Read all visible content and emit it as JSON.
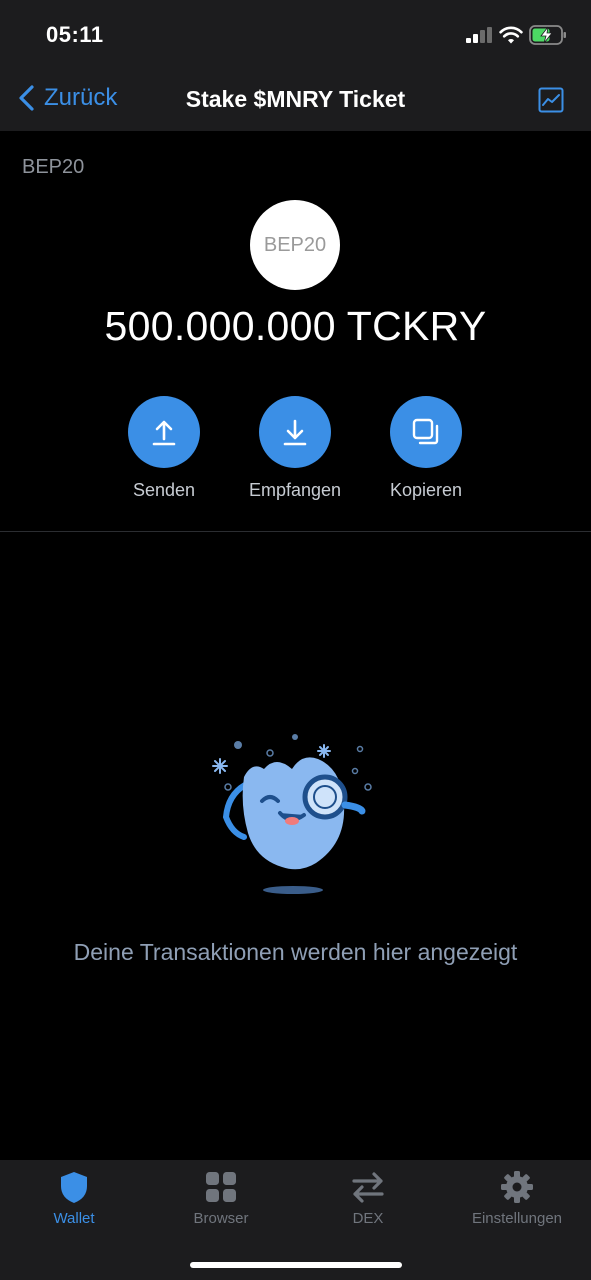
{
  "status_bar": {
    "time": "05:11"
  },
  "nav": {
    "back_label": "Zurück",
    "title": "Stake $MNRY Ticket"
  },
  "token": {
    "network_label": "BEP20",
    "logo_text": "BEP20",
    "balance": "500.000.000 TCKRY"
  },
  "actions": [
    {
      "label": "Senden",
      "icon": "upload-arrow-icon"
    },
    {
      "label": "Empfangen",
      "icon": "download-arrow-icon"
    },
    {
      "label": "Kopieren",
      "icon": "copy-icon"
    }
  ],
  "empty_state": {
    "text": "Deine Transaktionen werden hier angezeigt"
  },
  "tabbar": {
    "items": [
      {
        "label": "Wallet",
        "icon": "shield-icon",
        "active": true
      },
      {
        "label": "Browser",
        "icon": "grid-icon",
        "active": false
      },
      {
        "label": "DEX",
        "icon": "swap-arrows-icon",
        "active": false
      },
      {
        "label": "Einstellungen",
        "icon": "gear-icon",
        "active": false
      }
    ]
  },
  "colors": {
    "accent": "#3b8fe6",
    "background": "#000000",
    "bar": "#1c1c1e",
    "battery": "#4cd964"
  }
}
